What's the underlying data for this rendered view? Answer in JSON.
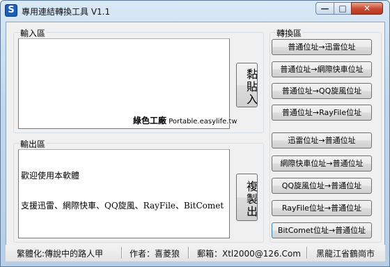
{
  "window": {
    "title": "專用連結轉換工具 V1.1",
    "icon_letter": "S"
  },
  "input_group": {
    "label": "輸入區",
    "paste_button": "黏貼入"
  },
  "watermark": {
    "brand": "綠色工廠",
    "site": "Portable.easylife.tw"
  },
  "output_group": {
    "label": "輸出區",
    "lines": [
      "歡迎使用本軟體",
      "支援迅雷、網際快車、QQ旋風、RayFile、BitComet"
    ],
    "copy_button": "複製出"
  },
  "convert_group": {
    "label": "轉換區",
    "buttons": [
      "普通位址→迅雷位址",
      "普通位址→網際快車位址",
      "普通位址→QQ旋風位址",
      "普通位址→RayFile位址",
      "迅雷位址→普通位址",
      "網際快車位址→普通位址",
      "QQ旋風位址→普通位址",
      "RayFile位址→普通位址",
      "BitComet位址→普通位址"
    ]
  },
  "status": {
    "translator": "繁體化:傳說中的路人甲",
    "author": "作者：喜菱狼",
    "email": "郵箱：Xtl2000@126.Com",
    "location": "黑龍江省鶴崗市"
  }
}
